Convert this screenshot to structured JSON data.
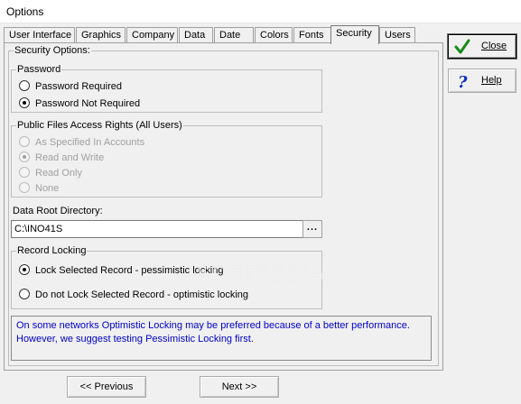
{
  "window": {
    "title": "Options"
  },
  "tabs": [
    {
      "label": "User Interface"
    },
    {
      "label": "Graphics"
    },
    {
      "label": "Company"
    },
    {
      "label": "Data"
    },
    {
      "label": "Date"
    },
    {
      "label": "Colors"
    },
    {
      "label": "Fonts"
    },
    {
      "label": "Security",
      "active": true
    },
    {
      "label": "Users"
    }
  ],
  "security": {
    "title": "Security Options:",
    "password": {
      "title": "Password",
      "options": [
        "Password Required",
        "Password Not Required"
      ],
      "selected": "Password Not Required"
    },
    "public_files": {
      "title": "Public Files Access Rights (All Users)",
      "options": [
        "As Specified In Accounts",
        "Read and Write",
        "Read Only",
        "None"
      ],
      "selected": "Read and Write",
      "disabled": true
    },
    "data_root": {
      "label": "Data Root Directory:",
      "value": "C:\\INO41S",
      "browse_label": "..."
    },
    "record_locking": {
      "title": "Record Locking",
      "options": [
        "Lock Selected Record - pessimistic locking",
        "Do not Lock Selected Record - optimistic locking"
      ],
      "selected": "Lock Selected Record - pessimistic locking"
    },
    "info_line1": "On some networks Optimistic Locking may be preferred because of a better performance.",
    "info_line2": "However, we suggest testing Pessimistic Locking first."
  },
  "buttons": {
    "close": "Close",
    "help": "Help",
    "previous": "<< Previous",
    "next": "Next >>"
  },
  "icons": {
    "close": "checkmark-icon",
    "help": "question-icon"
  },
  "colors": {
    "info_text": "#0000c8",
    "check_green": "#1a8a1a",
    "help_blue": "#1030c0"
  },
  "watermark": "SOFTPEDIA"
}
